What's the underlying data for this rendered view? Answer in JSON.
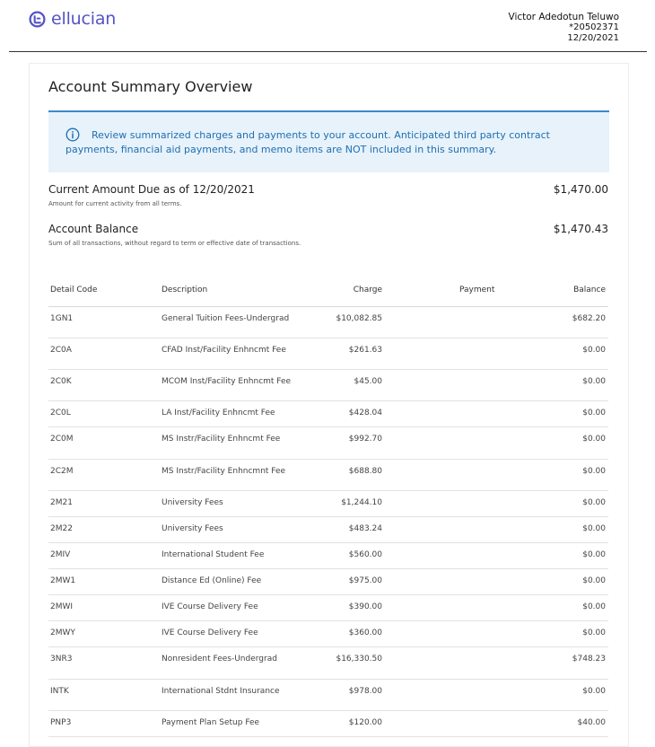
{
  "brand": {
    "name": "ellucian",
    "logo_icon": "ellucian-logo-icon",
    "color": "#5553c6"
  },
  "user": {
    "name": "Victor Adedotun Teluwo",
    "id": "*20502371",
    "date": "12/20/2021"
  },
  "page": {
    "title": "Account Summary Overview",
    "info_icon": "info-circle-icon",
    "info_text": "Review summarized charges and payments to your account. Anticipated third party contract payments, financial aid payments, and memo items are NOT included in this summary."
  },
  "summary": {
    "current_due_label": "Current Amount Due  as of 12/20/2021",
    "current_due_sub": "Amount for current activity from all terms.",
    "current_due_amount": "$1,470.00",
    "balance_label": "Account Balance",
    "balance_sub": "Sum of all transactions, without regard to term or effective date of transactions.",
    "balance_amount": "$1,470.43"
  },
  "table": {
    "headers": {
      "code": "Detail Code",
      "desc": "Description",
      "charge": "Charge",
      "payment": "Payment",
      "balance": "Balance"
    },
    "rows": [
      {
        "code": "1GN1",
        "desc": "General Tuition Fees-Undergrad",
        "charge": "$10,082.85",
        "payment": "",
        "balance": "$682.20"
      },
      {
        "code": "2C0A",
        "desc": "CFAD Inst/Facility Enhncmt Fee",
        "charge": "$261.63",
        "payment": "",
        "balance": "$0.00"
      },
      {
        "code": "2C0K",
        "desc": "MCOM Inst/Facility Enhncmt Fee",
        "charge": "$45.00",
        "payment": "",
        "balance": "$0.00"
      },
      {
        "code": "2C0L",
        "desc": "LA Inst/Facility Enhncmt Fee",
        "charge": "$428.04",
        "payment": "",
        "balance": "$0.00"
      },
      {
        "code": "2C0M",
        "desc": "MS Instr/Facility Enhncmt Fee",
        "charge": "$992.70",
        "payment": "",
        "balance": "$0.00"
      },
      {
        "code": "2C2M",
        "desc": "MS Instr/Facility Enhncmnt Fee",
        "charge": "$688.80",
        "payment": "",
        "balance": "$0.00"
      },
      {
        "code": "2M21",
        "desc": "University Fees",
        "charge": "$1,244.10",
        "payment": "",
        "balance": "$0.00"
      },
      {
        "code": "2M22",
        "desc": "University Fees",
        "charge": "$483.24",
        "payment": "",
        "balance": "$0.00"
      },
      {
        "code": "2MIV",
        "desc": "International Student Fee",
        "charge": "$560.00",
        "payment": "",
        "balance": "$0.00"
      },
      {
        "code": "2MW1",
        "desc": "Distance Ed (Online) Fee",
        "charge": "$975.00",
        "payment": "",
        "balance": "$0.00"
      },
      {
        "code": "2MWI",
        "desc": "IVE Course Delivery Fee",
        "charge": "$390.00",
        "payment": "",
        "balance": "$0.00"
      },
      {
        "code": "2MWY",
        "desc": "IVE Course Delivery Fee",
        "charge": "$360.00",
        "payment": "",
        "balance": "$0.00"
      },
      {
        "code": "3NR3",
        "desc": "Nonresident Fees-Undergrad",
        "charge": "$16,330.50",
        "payment": "",
        "balance": "$748.23"
      },
      {
        "code": "INTK",
        "desc": "International Stdnt Insurance",
        "charge": "$978.00",
        "payment": "",
        "balance": "$0.00"
      },
      {
        "code": "PNP3",
        "desc": "Payment Plan Setup Fee",
        "charge": "$120.00",
        "payment": "",
        "balance": "$40.00"
      }
    ]
  }
}
